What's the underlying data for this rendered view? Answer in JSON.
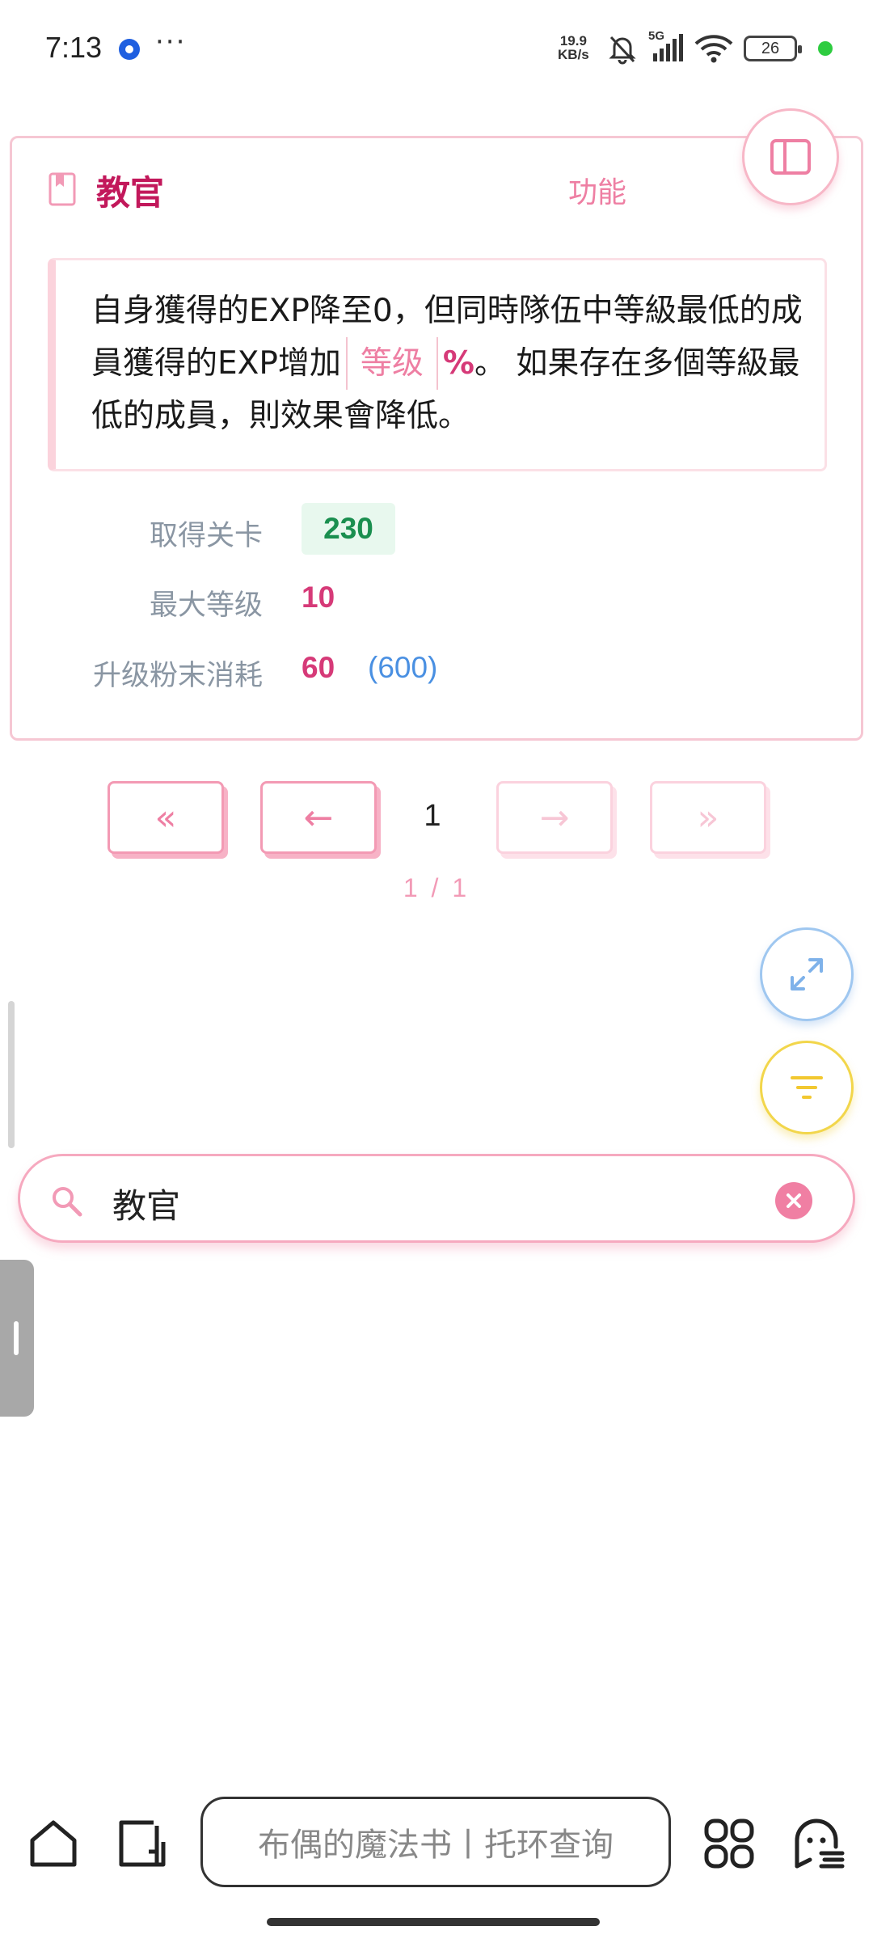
{
  "status_bar": {
    "time": "7:13",
    "more": "···",
    "net_speed_value": "19.9",
    "net_speed_unit": "KB/s",
    "network": "5G",
    "battery": "26",
    "icons": [
      "app-circle-icon",
      "bell-off-icon",
      "signal-icon",
      "wifi-icon",
      "battery-icon"
    ]
  },
  "card": {
    "title": "教官",
    "function_link": "功能",
    "description": {
      "part1": "自身獲得的EXP降至0，但同時隊伍中等級最低的成員獲得的EXP增加",
      "variable": "等级",
      "percent": "%",
      "part2": "。 如果存在多個等級最低的成員，則效果會降低。"
    },
    "stats": {
      "stage_label": "取得关卡",
      "stage_value": "230",
      "max_level_label": "最大等级",
      "max_level_value": "10",
      "upgrade_label": "升级粉末消耗",
      "upgrade_value": "60",
      "upgrade_total": "(600)"
    }
  },
  "pagination": {
    "first": "«",
    "prev": "←",
    "current": "1",
    "next": "→",
    "last": "»",
    "info": "1 / 1"
  },
  "search": {
    "value": "教官"
  },
  "bottom_nav": {
    "address_text": "布偶的魔法书丨托环查询",
    "icons": [
      "home-icon",
      "tabs-icon",
      "apps-icon",
      "ghost-menu-icon"
    ]
  },
  "colors": {
    "accent_pink": "#ee7fa3",
    "title_red": "#c2185b",
    "value_magenta": "#d63a78",
    "green": "#1a8f4f",
    "blue": "#4a90e2",
    "yellow": "#f2d64b"
  }
}
